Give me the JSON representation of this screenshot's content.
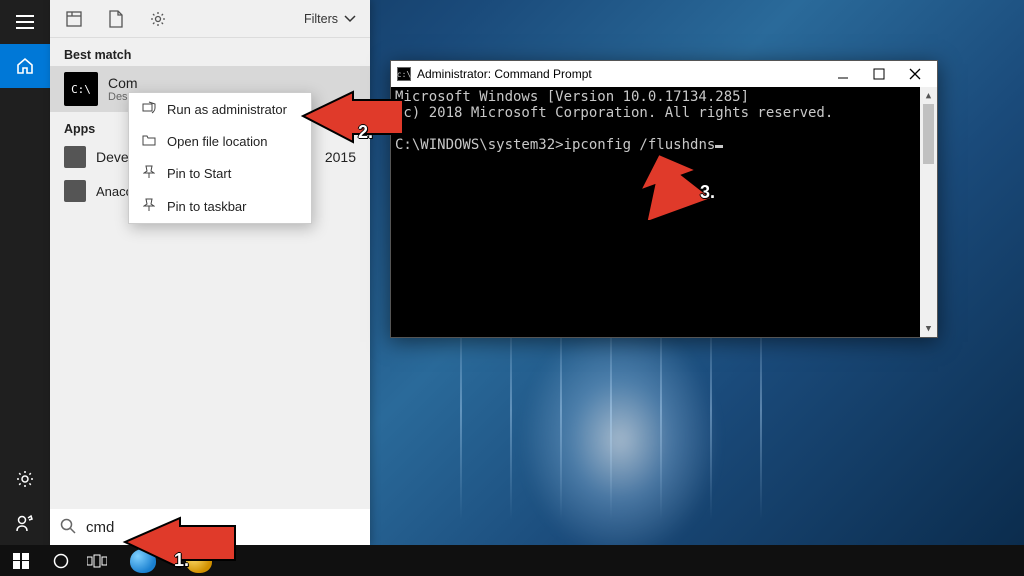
{
  "cortana": {
    "filters_label": "Filters",
    "best_match_label": "Best match",
    "apps_label": "Apps",
    "best_match_item": {
      "title": "Com",
      "subtitle": "Deskt"
    },
    "apps": [
      {
        "name": "Develo",
        "suffix": "2015"
      },
      {
        "name": "Anacor"
      }
    ]
  },
  "context_menu": {
    "items": [
      {
        "label": "Run as administrator"
      },
      {
        "label": "Open file location"
      },
      {
        "label": "Pin to Start"
      },
      {
        "label": "Pin to taskbar"
      }
    ]
  },
  "search": {
    "value": "cmd"
  },
  "cmd": {
    "title": "Administrator: Command Prompt",
    "line1": "Microsoft Windows [Version 10.0.17134.285]",
    "line2": "(c) 2018 Microsoft Corporation. All rights reserved.",
    "prompt": "C:\\WINDOWS\\system32>",
    "command": "ipconfig /flushdns"
  },
  "annotations": {
    "step1": "1.",
    "step2": "2.",
    "step3": "3."
  }
}
